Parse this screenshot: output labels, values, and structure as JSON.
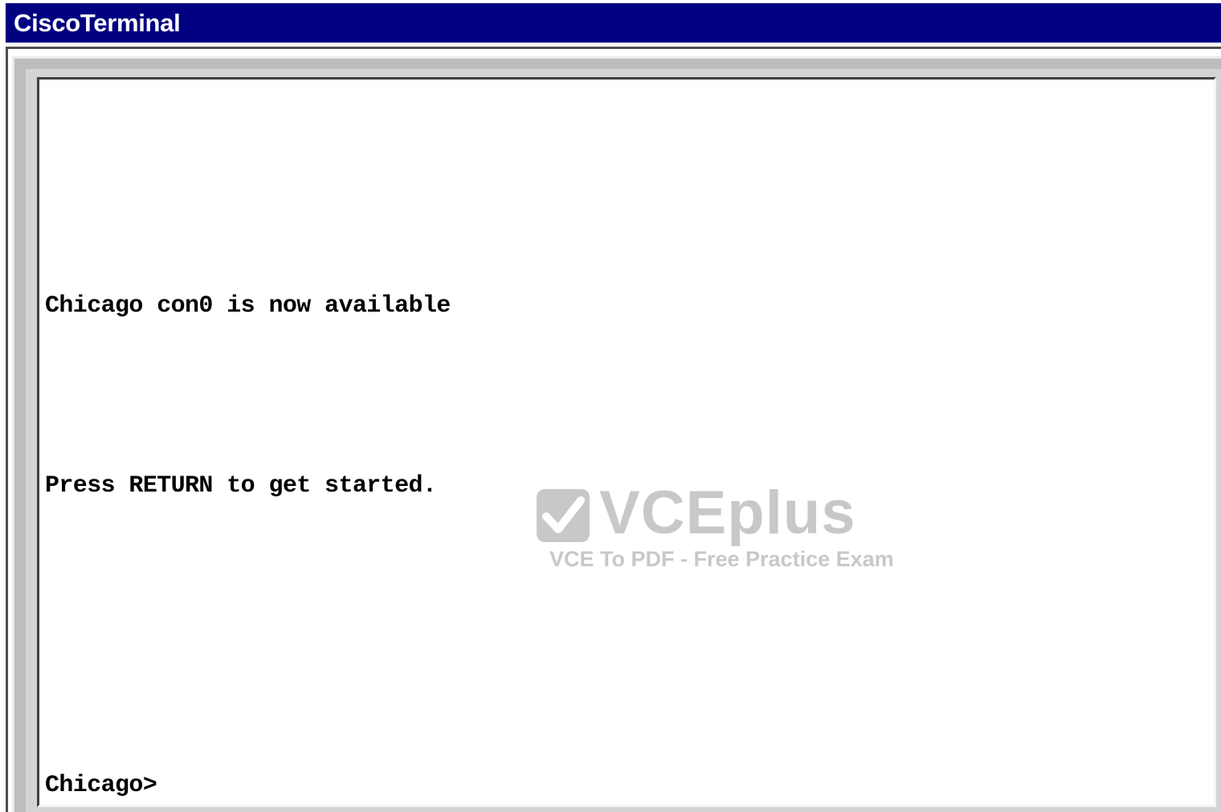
{
  "window": {
    "title": "CiscoTerminal"
  },
  "terminal": {
    "lines": [
      "Chicago con0 is now available",
      "Press RETURN to get started.",
      "Chicago>"
    ]
  },
  "watermark": {
    "icon": "checkmark-icon",
    "brand": "VCEplus",
    "tagline": "VCE To PDF - Free Practice Exam"
  },
  "colors": {
    "titlebar": "#000080",
    "titletext": "#ffffff",
    "frame": "#bdbdbd",
    "terminal_bg": "#ffffff",
    "terminal_text": "#000000",
    "watermark": "#c8c8c8"
  }
}
